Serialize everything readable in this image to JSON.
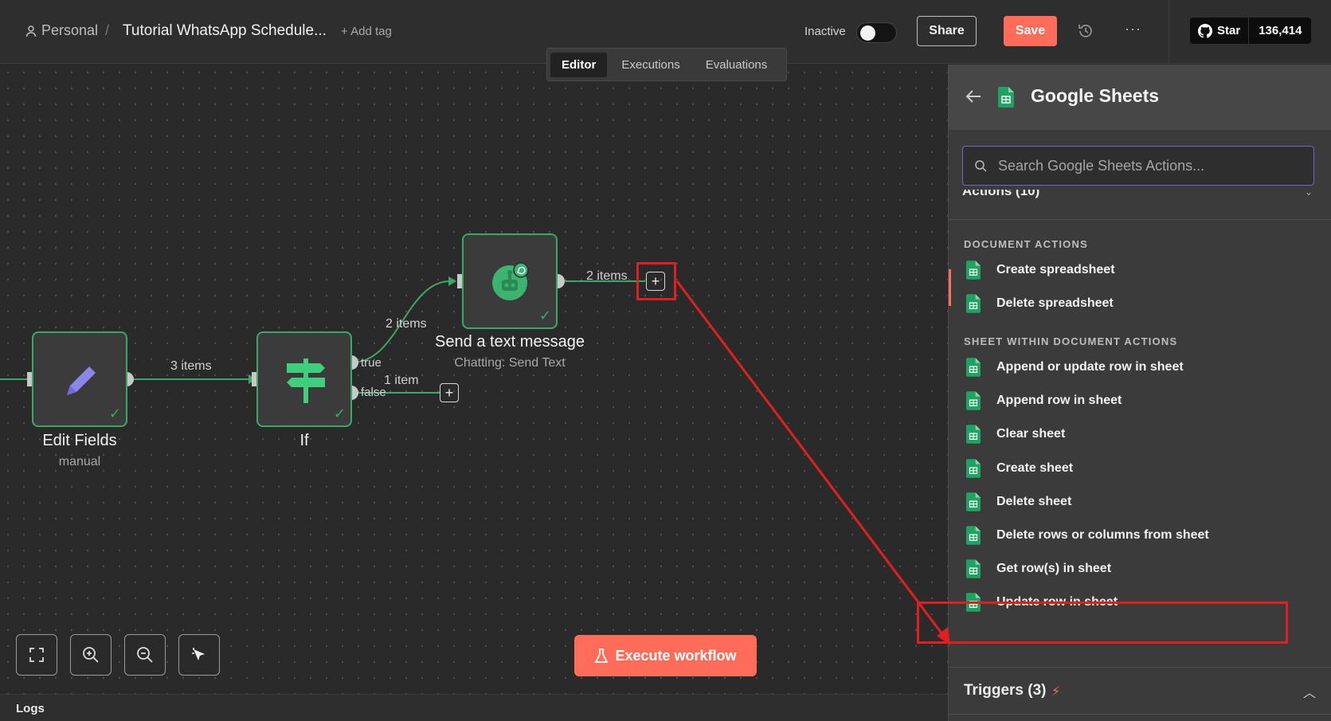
{
  "header": {
    "breadcrumb_personal": "Personal",
    "breadcrumb_sep": "/",
    "workflow_title": "Tutorial WhatsApp Schedule...",
    "add_tag": "+ Add tag",
    "status_label": "Inactive",
    "share_label": "Share",
    "save_label": "Save",
    "more_label": "···",
    "github_star_label": "Star",
    "github_star_count": "136,414"
  },
  "tabs": [
    {
      "label": "Editor",
      "active": true
    },
    {
      "label": "Executions",
      "active": false
    },
    {
      "label": "Evaluations",
      "active": false
    }
  ],
  "nodes": {
    "edit_fields": {
      "title": "Edit Fields",
      "subtitle": "manual",
      "icon": "pencil-icon"
    },
    "if": {
      "title": "If",
      "icon": "signpost-icon"
    },
    "send_message": {
      "title": "Send a text message",
      "subtitle": "Chatting: Send Text",
      "icon": "whatsapp-bot-icon"
    }
  },
  "connections": {
    "edit_to_if": "3 items",
    "if_true_label": "true",
    "if_false_label": "false",
    "if_true_items": "2 items",
    "if_false_items": "1 item",
    "send_out_items": "2 items"
  },
  "canvas": {
    "execute_label": "Execute workflow",
    "logs_label": "Logs"
  },
  "panel": {
    "title": "Google Sheets",
    "search_placeholder": "Search Google Sheets Actions...",
    "actions_header": "Actions (10)",
    "section_document": "DOCUMENT ACTIONS",
    "document_actions": [
      "Create spreadsheet",
      "Delete spreadsheet"
    ],
    "section_sheet": "SHEET WITHIN DOCUMENT ACTIONS",
    "sheet_actions": [
      "Append or update row in sheet",
      "Append row in sheet",
      "Clear sheet",
      "Create sheet",
      "Delete sheet",
      "Delete rows or columns from sheet",
      "Get row(s) in sheet",
      "Update row in sheet"
    ],
    "triggers_label": "Triggers (3)"
  },
  "colors": {
    "accent": "#ff6d5a",
    "node_border": "#3ba86a",
    "sheets_green": "#1ea362",
    "annotation_red": "#e02020",
    "search_focus": "#6e6acc"
  }
}
